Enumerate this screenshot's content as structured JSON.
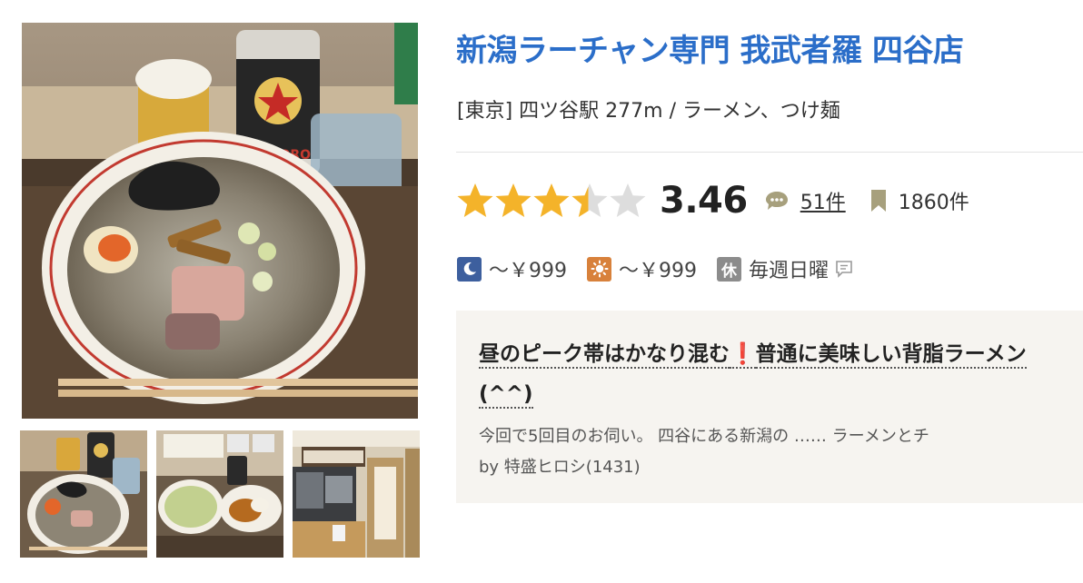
{
  "restaurant": {
    "name": "新潟ラーチャン専門 我武者羅 四谷店",
    "area": "[東京] 四ツ谷駅 277m / ラーメン、つけ麺"
  },
  "rating": {
    "score": "3.46",
    "stars_value": 3.46,
    "stars_max": 5,
    "review_count": "51件",
    "bookmark_count": "1860件"
  },
  "budget": {
    "night_price": "～￥999",
    "day_price": "～￥999",
    "holiday_badge": "休",
    "holiday": "毎週日曜"
  },
  "review": {
    "title_part1": "昼のピーク帯はかなり混む",
    "title_mark": "❗",
    "title_part2": "普通に美味しい背脂ラーメン",
    "title_line2": "(^^)",
    "snippet": "今回で5回目のお伺い。 四谷にある新潟の …… ラーメンとチ",
    "author": "by 特盛ヒロシ(1431)"
  },
  "photos": {
    "main_brand": "SAPPORO",
    "thumb_count": 3
  },
  "colors": {
    "title_blue": "#2b6ec9",
    "star_gold": "#f4b32a",
    "star_empty": "#dddddd",
    "night_badge": "#3d5f9e",
    "day_badge": "#d8813b",
    "holiday_badge": "#8c8c8c",
    "review_bg": "#f6f4f0",
    "accent_red": "#e0202a"
  },
  "icons": {
    "review": "speech-bubble-icon",
    "bookmark": "bookmark-icon",
    "night": "moon-icon",
    "day": "sun-icon",
    "comment": "comment-icon"
  }
}
